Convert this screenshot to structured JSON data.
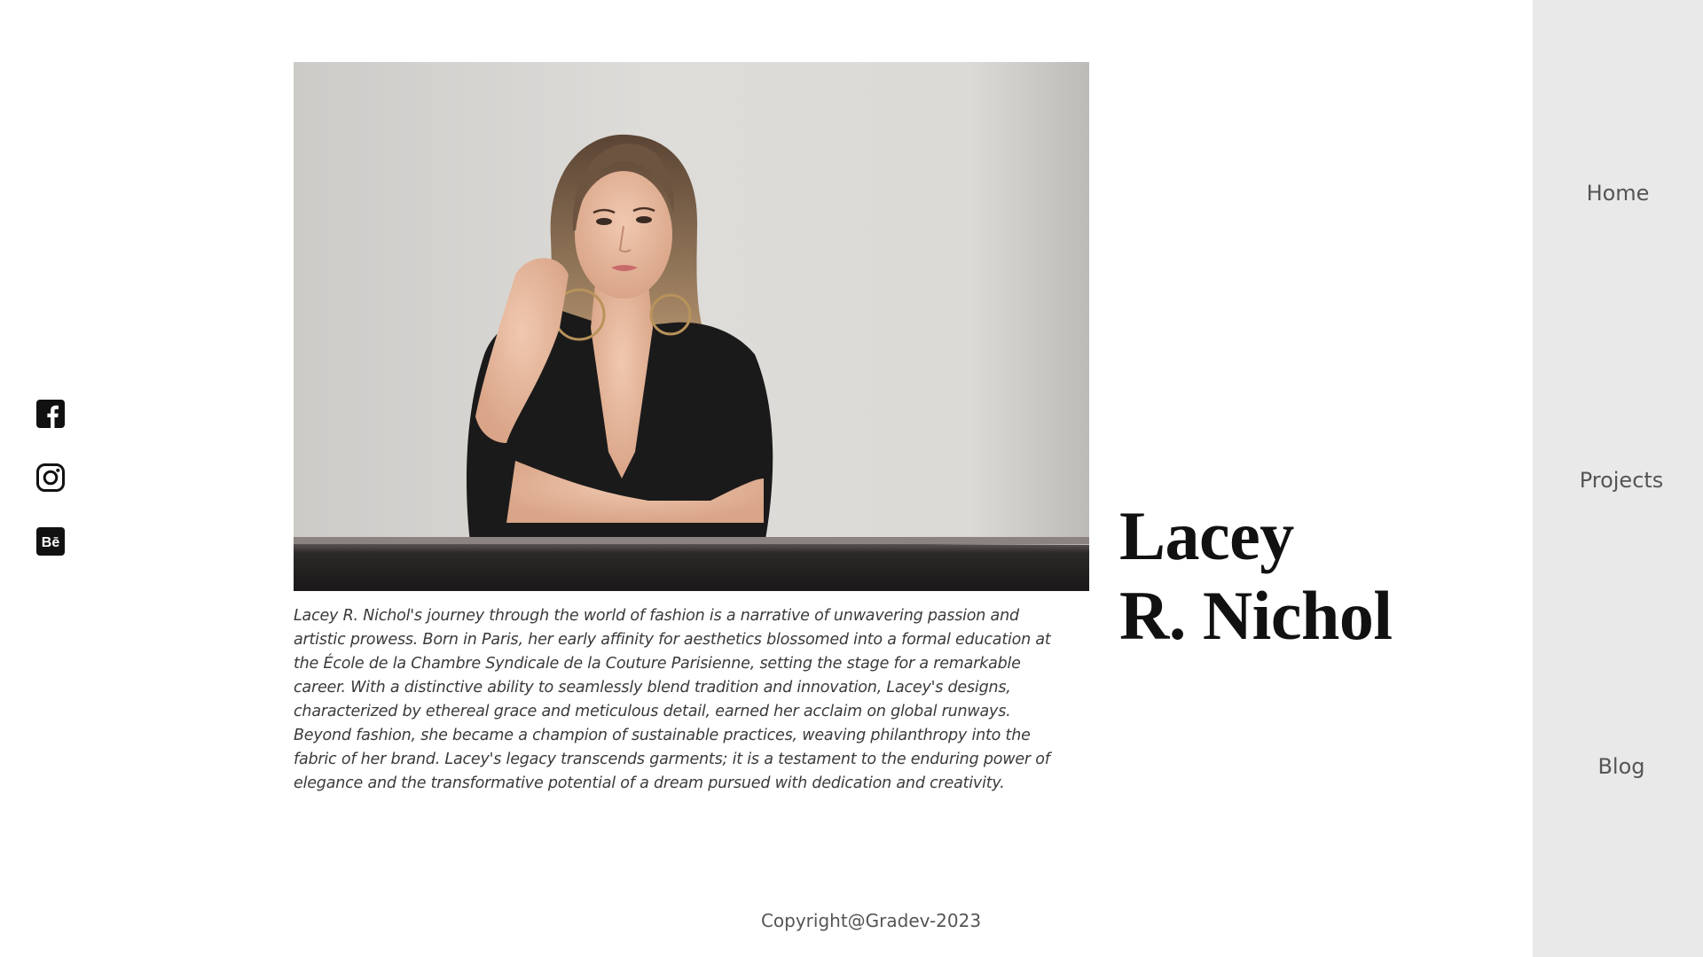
{
  "social": {
    "items": [
      {
        "name": "facebook",
        "icon": "facebook-square-icon"
      },
      {
        "name": "instagram",
        "icon": "instagram-icon"
      },
      {
        "name": "behance",
        "icon": "behance-square-icon",
        "glyph": "Bē"
      }
    ]
  },
  "hero": {
    "photo": "portrait-photo"
  },
  "bio": {
    "text": "Lacey R. Nichol's journey through the world of fashion is a narrative of unwavering passion and artistic prowess. Born in Paris, her early affinity for aesthetics blossomed into a formal education at the École de la Chambre Syndicale de la Couture Parisienne, setting the stage for a remarkable career. With a distinctive ability to seamlessly blend tradition and innovation, Lacey's designs, characterized by ethereal grace and meticulous detail, earned her acclaim on global runways. Beyond fashion, she became a champion of sustainable practices, weaving philanthropy into the fabric of her brand. Lacey's legacy transcends garments; it is a testament to the enduring power of elegance and the transformative potential of a dream pursued with dedication and creativity."
  },
  "name": {
    "line1": "Lacey",
    "line2": "R. Nichol"
  },
  "nav": {
    "home": "Home",
    "projects": "Projects",
    "blog": "Blog"
  },
  "footer": {
    "copyright": "Copyright@Gradev-2023"
  },
  "colors": {
    "nav_bg": "#e9e9e9",
    "text": "#111111",
    "muted": "#555555"
  }
}
